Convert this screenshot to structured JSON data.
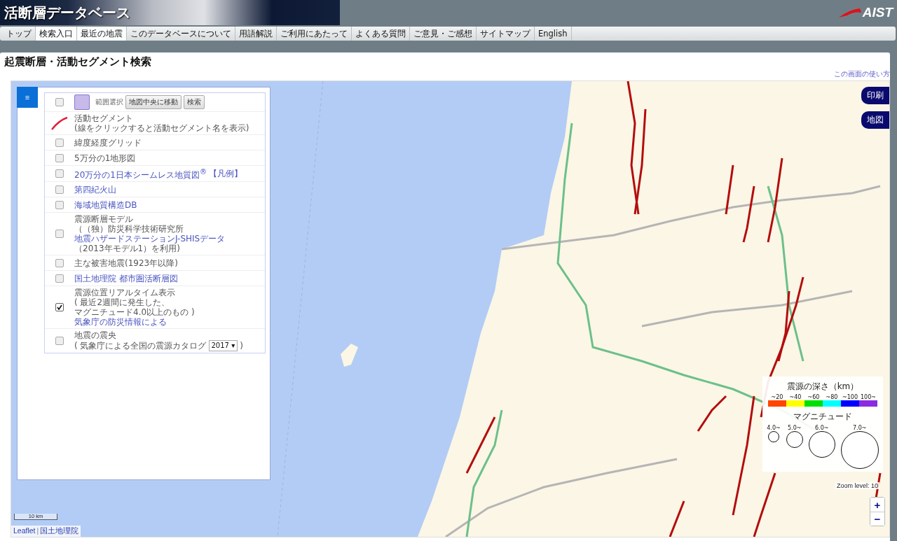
{
  "header": {
    "title": "活断層データベース",
    "logo": "AIST"
  },
  "nav": [
    {
      "label": "トップ",
      "highlighted": false
    },
    {
      "label": "検索入口",
      "highlighted": true
    },
    {
      "label": "最近の地震",
      "highlighted": true
    },
    {
      "label": "このデータベースについて",
      "highlighted": false
    },
    {
      "label": "用語解説",
      "highlighted": false
    },
    {
      "label": "ご利用にあたって",
      "highlighted": false
    },
    {
      "label": "よくある質問",
      "highlighted": false
    },
    {
      "label": "ご意見・ご感想",
      "highlighted": false
    },
    {
      "label": "サイトマップ",
      "highlighted": false
    },
    {
      "label": "English",
      "highlighted": false
    }
  ],
  "page_title": "起震断層・活動セグメント検索",
  "help_link": "この画面の使い方",
  "map": {
    "menu_button": "≡",
    "side_buttons": [
      "印刷",
      "地図"
    ],
    "layers": [
      {
        "kind": "range",
        "checked": false,
        "label": "範囲選択",
        "buttons": [
          "地図中央に移動",
          "検索"
        ]
      },
      {
        "kind": "line",
        "lines": [
          [
            {
              "kind": "text",
              "text": "活動セグメント"
            }
          ],
          [
            {
              "kind": "text",
              "text": "(線をクリックすると活動セグメント名を表示)"
            }
          ]
        ]
      },
      {
        "kind": "checkbox",
        "checked": false,
        "lines": [
          [
            {
              "kind": "text",
              "text": "緯度経度グリッド"
            }
          ]
        ]
      },
      {
        "kind": "checkbox",
        "checked": false,
        "lines": [
          [
            {
              "kind": "text",
              "text": "5万分の1地形図"
            }
          ]
        ]
      },
      {
        "kind": "checkbox",
        "checked": false,
        "lines": [
          [
            {
              "kind": "link",
              "text": "20万分の1日本シームレス地質図$^{®}$"
            },
            {
              "kind": "link",
              "text": "【凡例】"
            }
          ]
        ]
      },
      {
        "kind": "checkbox",
        "checked": false,
        "lines": [
          [
            {
              "kind": "link",
              "text": "第四紀火山"
            }
          ]
        ]
      },
      {
        "kind": "checkbox",
        "checked": false,
        "lines": [
          [
            {
              "kind": "link",
              "text": "海域地質構造DB"
            }
          ]
        ]
      },
      {
        "kind": "checkbox",
        "checked": false,
        "lines": [
          [
            {
              "kind": "text",
              "text": "震源断層モデル"
            }
          ],
          [
            {
              "kind": "text",
              "text": "（（独）防災科学技術研究所"
            }
          ],
          [
            {
              "kind": "link",
              "text": "地震ハザードステーションJ-SHISデータ"
            }
          ],
          [
            {
              "kind": "text",
              "text": "（2013年モデル1）を利用)"
            }
          ]
        ]
      },
      {
        "kind": "checkbox",
        "checked": false,
        "lines": [
          [
            {
              "kind": "text",
              "text": "主な被害地震(1923年以降)"
            }
          ]
        ]
      },
      {
        "kind": "checkbox",
        "checked": false,
        "lines": [
          [
            {
              "kind": "link",
              "text": "国土地理院 都市圏活断層図"
            }
          ]
        ]
      },
      {
        "kind": "checkbox",
        "checked": true,
        "lines": [
          [
            {
              "kind": "text",
              "text": "震源位置リアルタイム表示"
            }
          ],
          [
            {
              "kind": "text",
              "text": "( 最近2週間に発生した、"
            }
          ],
          [
            {
              "kind": "text",
              "text": "マグニチュード4.0以上のもの )"
            }
          ],
          [
            {
              "kind": "link",
              "text": "気象庁の防災情報による"
            }
          ]
        ]
      },
      {
        "kind": "checkbox",
        "checked": false,
        "lines": [
          [
            {
              "kind": "text",
              "text": "地震の震央"
            }
          ],
          [
            {
              "kind": "text",
              "text": "( 気象庁による全国の震源カタログ"
            },
            {
              "kind": "select",
              "text": "2017 ▾"
            },
            {
              "kind": "text",
              "text": ")"
            }
          ]
        ]
      }
    ],
    "legend": {
      "depth_title": "震源の深さ（km）",
      "depths": [
        {
          "label": "~20",
          "color": "#ff4500"
        },
        {
          "label": "~40",
          "color": "#ffff00"
        },
        {
          "label": "~60",
          "color": "#00e000"
        },
        {
          "label": "~80",
          "color": "#00ffff"
        },
        {
          "label": "~100",
          "color": "#0000ff"
        },
        {
          "label": "100~",
          "color": "#8a2be2"
        }
      ],
      "magnitude_title": "マグニチュード",
      "magnitudes": [
        "4.0~",
        "5.0~",
        "6.0~",
        "7.0~"
      ]
    },
    "zoom_level": "Zoom level: 10",
    "zoom_in": "+",
    "zoom_out": "−",
    "scale": "10 km",
    "attribution": [
      {
        "text": "Leaflet"
      },
      {
        "text": "国土地理院"
      }
    ],
    "attribution_separator": "|"
  }
}
